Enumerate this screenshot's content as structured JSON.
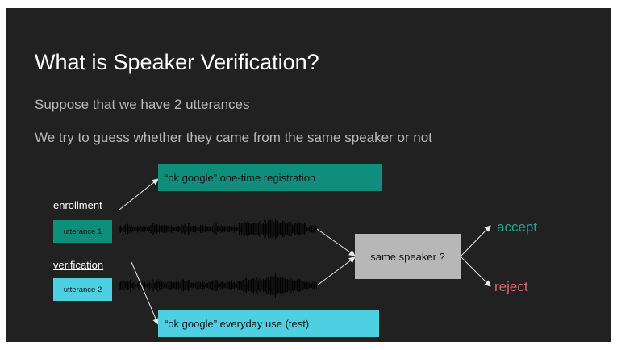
{
  "slide": {
    "title": "What is Speaker Verification?",
    "bullets": [
      "Suppose that we have 2 utterances",
      "We try to guess whether they came from the same speaker or not"
    ]
  },
  "diagram": {
    "enrollment_label": "enrollment",
    "verification_label": "verification",
    "utterance_1": "utterance 1",
    "utterance_2": "utterance 2",
    "enrollment_note": "“ok google” one-time registration",
    "verification_note": "“ok google” everyday use (test)",
    "decision": "same speaker ?",
    "accept": "accept",
    "reject": "reject"
  },
  "colors": {
    "background": "#212121",
    "title": "#ffffff",
    "body_text": "#b8b8b8",
    "enrollment_teal": "#0d8f7c",
    "verification_cyan": "#4dd0e1",
    "decision_grey": "#b7b7b7",
    "accept": "#27a38f",
    "reject": "#e06666",
    "waveform": "#000000"
  }
}
